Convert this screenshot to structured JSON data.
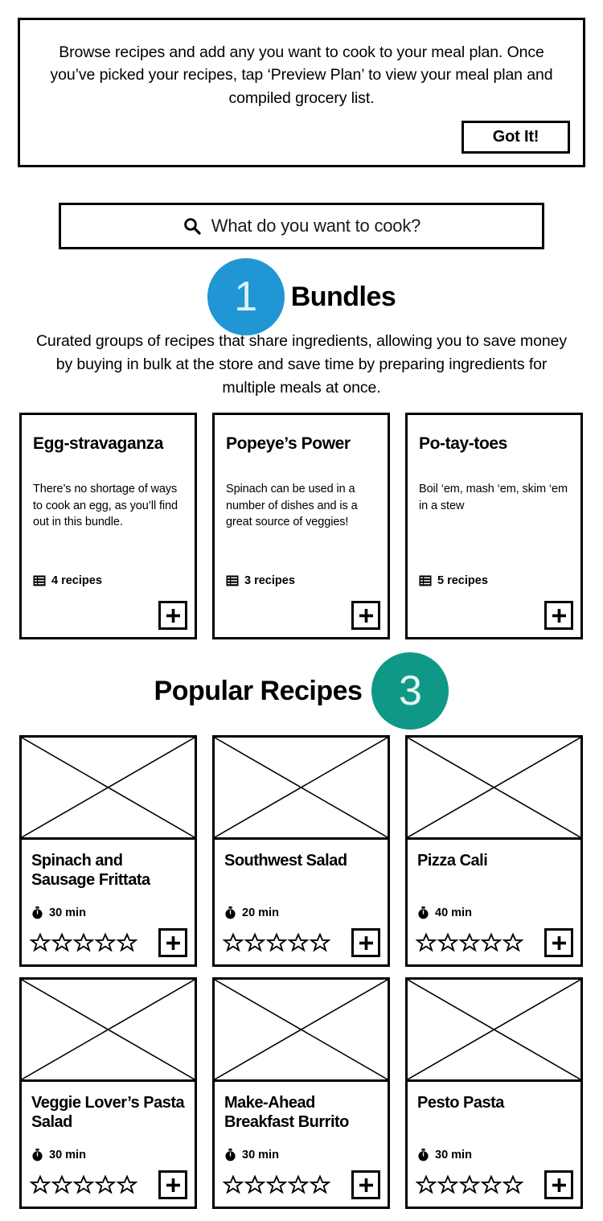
{
  "banner": {
    "message": "Browse recipes and add any you want to cook to your meal plan.  Once you’ve picked your recipes, tap ‘Preview Plan’ to view your meal plan and compiled grocery list.",
    "dismiss_label": "Got It!"
  },
  "search": {
    "placeholder": "What do you want to cook?",
    "icon": "search-icon"
  },
  "bundles_section": {
    "step_number": "1",
    "step_color": "#2196d4",
    "title": "Bundles",
    "description": "Curated groups of recipes that share ingredients, allowing you to save money by buying in bulk at the store and save time by preparing ingredients for multiple meals at once.",
    "cards": [
      {
        "title": "Egg-stravaganza",
        "description": "There’s no shortage of ways to cook an egg, as you’ll find out in this bundle.",
        "count_label": "4 recipes",
        "count_icon": "list-icon",
        "add_label": "+"
      },
      {
        "title": "Popeye’s Power",
        "description": "Spinach can be used in a number of dishes and is a great source of veggies!",
        "count_label": "3 recipes",
        "count_icon": "list-icon",
        "add_label": "+"
      },
      {
        "title": "Po-tay-toes",
        "description": "Boil ‘em, mash ‘em, skim ‘em in a stew",
        "count_label": "5 recipes",
        "count_icon": "list-icon",
        "add_label": "+"
      }
    ]
  },
  "popular_section": {
    "title": "Popular Recipes",
    "step_number": "3",
    "step_color": "#109887",
    "recipes": [
      {
        "title": "Spinach and Sausage Frittata",
        "time": "30 min",
        "time_icon": "timer-icon",
        "rating": 0,
        "max_rating": 5,
        "add_label": "+"
      },
      {
        "title": "Southwest Salad",
        "time": "20 min",
        "time_icon": "timer-icon",
        "rating": 0,
        "max_rating": 5,
        "add_label": "+"
      },
      {
        "title": "Pizza Cali",
        "time": "40 min",
        "time_icon": "timer-icon",
        "rating": 0,
        "max_rating": 5,
        "add_label": "+"
      },
      {
        "title": "Veggie Lover’s Pasta Salad",
        "time": "30 min",
        "time_icon": "timer-icon",
        "rating": 0,
        "max_rating": 5,
        "add_label": "+"
      },
      {
        "title": "Make-Ahead Breakfast Burrito",
        "time": "30 min",
        "time_icon": "timer-icon",
        "rating": 0,
        "max_rating": 5,
        "add_label": "+"
      },
      {
        "title": "Pesto Pasta",
        "time": "30 min",
        "time_icon": "timer-icon",
        "rating": 0,
        "max_rating": 5,
        "add_label": "+"
      }
    ]
  }
}
